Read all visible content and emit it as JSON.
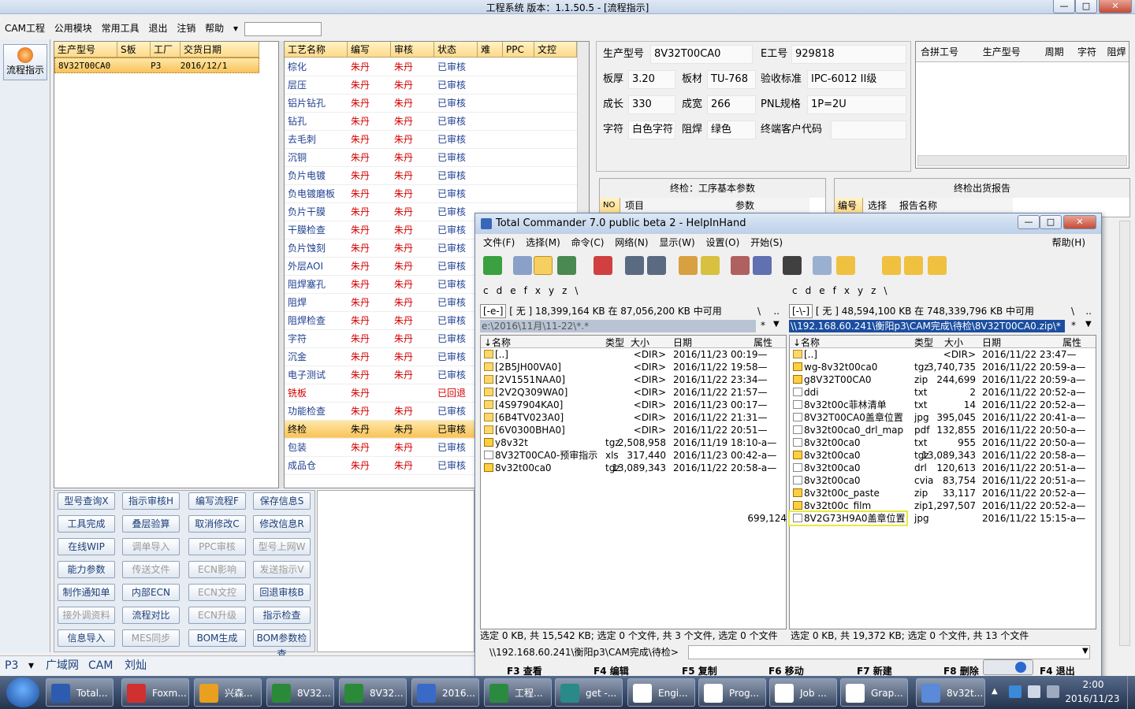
{
  "window": {
    "title": "工程系统  版本：1.1.50.5 - [流程指示]",
    "btn_min": "—",
    "btn_max": "□",
    "btn_close": "✕"
  },
  "menu": [
    "CAM工程",
    "公用模块",
    "常用工具",
    "退出",
    "注销",
    "帮助"
  ],
  "menu_help_arrow": "▾",
  "side": {
    "flow_label": "流程指示"
  },
  "orders": {
    "headers": [
      "生产型号",
      "S板",
      "工厂",
      "交货日期"
    ],
    "row": [
      "8V32T00CA0",
      "",
      "P3",
      "2016/12/1"
    ]
  },
  "process": {
    "headers": [
      "工艺名称",
      "编写",
      "审核",
      "状态",
      "难",
      "PPC",
      "文控"
    ],
    "rows": [
      [
        "棕化",
        "朱丹",
        "朱丹",
        "已审核"
      ],
      [
        "层压",
        "朱丹",
        "朱丹",
        "已审核"
      ],
      [
        "铝片钻孔",
        "朱丹",
        "朱丹",
        "已审核"
      ],
      [
        "钻孔",
        "朱丹",
        "朱丹",
        "已审核"
      ],
      [
        "去毛刺",
        "朱丹",
        "朱丹",
        "已审核"
      ],
      [
        "沉铜",
        "朱丹",
        "朱丹",
        "已审核"
      ],
      [
        "负片电镀",
        "朱丹",
        "朱丹",
        "已审核"
      ],
      [
        "负电镀磨板",
        "朱丹",
        "朱丹",
        "已审核"
      ],
      [
        "负片干膜",
        "朱丹",
        "朱丹",
        "已审核"
      ],
      [
        "干膜检查",
        "朱丹",
        "朱丹",
        "已审核"
      ],
      [
        "负片蚀刻",
        "朱丹",
        "朱丹",
        "已审核"
      ],
      [
        "外层AOI",
        "朱丹",
        "朱丹",
        "已审核"
      ],
      [
        "阻焊塞孔",
        "朱丹",
        "朱丹",
        "已审核"
      ],
      [
        "阻焊",
        "朱丹",
        "朱丹",
        "已审核"
      ],
      [
        "阻焊检查",
        "朱丹",
        "朱丹",
        "已审核"
      ],
      [
        "字符",
        "朱丹",
        "朱丹",
        "已审核"
      ],
      [
        "沉金",
        "朱丹",
        "朱丹",
        "已审核"
      ],
      [
        "电子测试",
        "朱丹",
        "朱丹",
        "已审核"
      ],
      [
        "铣板",
        "朱丹",
        "",
        "已回退"
      ],
      [
        "功能检查",
        "朱丹",
        "朱丹",
        "已审核"
      ],
      [
        "终检",
        "朱丹",
        "朱丹",
        "已审核"
      ],
      [
        "包装",
        "朱丹",
        "朱丹",
        "已审核"
      ],
      [
        "成品仓",
        "朱丹",
        "朱丹",
        "已审核"
      ]
    ]
  },
  "buttons": [
    [
      "型号查询X",
      "指示审核H",
      "编写流程F",
      "保存信息S"
    ],
    [
      "工具完成",
      "叠层验算",
      "取消修改C",
      "修改信息R"
    ],
    [
      "在线WIP",
      "调单导入",
      "PPC审核",
      "型号上网W"
    ],
    [
      "能力参数",
      "传送文件",
      "ECN影响",
      "发送指示V"
    ],
    [
      "制作通知单",
      "内部ECN",
      "ECN文控",
      "回退审核B"
    ],
    [
      "接外调资料",
      "流程对比",
      "ECN升级",
      "指示检查"
    ],
    [
      "信息导入",
      "MES同步",
      "BOM生成",
      "BOM参数检查"
    ]
  ],
  "info": {
    "model_l": "生产型号",
    "model": "8V32T00CA0",
    "eno_l": "E工号",
    "eno": "929818",
    "thick_l": "板厚",
    "thick": "3.20",
    "mat_l": "板材",
    "mat": "TU-768",
    "std_l": "验收标准",
    "std": "IPC-6012 II级",
    "len_l": "成长",
    "len": "330",
    "wid_l": "成宽",
    "wid": "266",
    "pnl_l": "PNL规格",
    "pnl": "1P=2U",
    "char_l": "字符",
    "char": "白色字符",
    "mask_l": "阻焊",
    "mask": "绿色",
    "cust_l": "终端客户代码",
    "cust": ""
  },
  "merge": {
    "headers": [
      "合拼工号",
      "生产型号",
      "周期",
      "字符",
      "阻焊"
    ]
  },
  "final": {
    "title": "终检：工序基本参数",
    "h": [
      "NO",
      "项目",
      "参数"
    ],
    "rtitle": "终检出货报告",
    "rh": [
      "编号",
      "选择",
      "报告名称"
    ]
  },
  "status_bar": {
    "factory": "P3",
    "net": "广域网",
    "mode": "CAM",
    "user": "刘灿"
  },
  "tc": {
    "title": "Total Commander 7.0 public beta 2 - HelpInHand",
    "menu": [
      "文件(F)",
      "选择(M)",
      "命令(C)",
      "网络(N)",
      "显示(W)",
      "设置(O)",
      "开始(S)"
    ],
    "help": "帮助(H)",
    "drives_l": [
      "c",
      "d",
      "e",
      "f",
      "x",
      "y",
      "z",
      "\\"
    ],
    "drives_r": [
      "c",
      "d",
      "e",
      "f",
      "x",
      "y",
      "z",
      "\\"
    ],
    "left": {
      "drive": "[-e-]",
      "free": "[ 无 ]  18,399,164 KB 在 87,056,200 KB 中可用",
      "path": "e:\\2016\\11月\\11-22\\*.*",
      "h": [
        "↓名称",
        "类型",
        "大小",
        "日期",
        "属性"
      ],
      "rows": [
        [
          "[..]",
          "",
          "<DIR>",
          "2016/11/23 00:19—"
        ],
        [
          "[2B5JH00VA0]",
          "",
          "<DIR>",
          "2016/11/22 19:58—"
        ],
        [
          "[2V1551NAA0]",
          "",
          "<DIR>",
          "2016/11/22 23:34—"
        ],
        [
          "[2V2Q309WA0]",
          "",
          "<DIR>",
          "2016/11/22 21:57—"
        ],
        [
          "[4S97904KA0]",
          "",
          "<DIR>",
          "2016/11/23 00:17—"
        ],
        [
          "[6B4TV023A0]",
          "",
          "<DIR>",
          "2016/11/22 21:31—"
        ],
        [
          "[6V0300BHA0]",
          "",
          "<DIR>",
          "2016/11/22 20:51—"
        ],
        [
          "y8v32t",
          "tgz",
          "2,508,958",
          "2016/11/19 18:10-a—"
        ],
        [
          "8V32T00CA0-预审指示",
          "xls",
          "317,440",
          "2016/11/23 00:42-a—"
        ],
        [
          "8v32t00ca0",
          "tgz",
          "13,089,343",
          "2016/11/22 20:58-a—"
        ]
      ],
      "status": "选定 0 KB, 共 15,542 KB; 选定 0 个文件, 共 3 个文件, 选定 0 个文件"
    },
    "right": {
      "drive": "[-\\-]",
      "free": "[ 无 ]  48,594,100 KB 在 748,339,796 KB 中可用",
      "path": "\\\\192.168.60.241\\衡阳p3\\CAM完成\\待检\\8V32T00CA0.zip\\*",
      "h": [
        "↓名称",
        "类型",
        "大小",
        "日期",
        "属性"
      ],
      "rows": [
        [
          "[..]",
          "",
          "<DIR>",
          "2016/11/22 23:47—"
        ],
        [
          "wg-8v32t00ca0",
          "tgz",
          "3,740,735",
          "2016/11/22 20:59-a—"
        ],
        [
          "g8V32T00CA0",
          "zip",
          "244,699",
          "2016/11/22 20:59-a—"
        ],
        [
          "ddi",
          "txt",
          "2",
          "2016/11/22 20:52-a—"
        ],
        [
          "8v32t00c菲林清单",
          "txt",
          "14",
          "2016/11/22 20:52-a—"
        ],
        [
          "8V32T00CA0盖章位置",
          "jpg",
          "395,045",
          "2016/11/22 20:41-a—"
        ],
        [
          "8v32t00ca0_drl_map",
          "pdf",
          "132,855",
          "2016/11/22 20:50-a—"
        ],
        [
          "8v32t00ca0",
          "txt",
          "955",
          "2016/11/22 20:50-a—"
        ],
        [
          "8v32t00ca0",
          "tgz",
          "13,089,343",
          "2016/11/22 20:58-a—"
        ],
        [
          "8v32t00ca0",
          "drl",
          "120,613",
          "2016/11/22 20:51-a—"
        ],
        [
          "8v32t00ca0",
          "cvia",
          "83,754",
          "2016/11/22 20:51-a—"
        ],
        [
          "8v32t00c_paste",
          "zip",
          "33,117",
          "2016/11/22 20:52-a—"
        ],
        [
          "8v32t00c_film",
          "zip",
          "1,297,507",
          "2016/11/22 20:52-a—"
        ],
        [
          "8V2G73H9A0盖章位置",
          "jpg",
          "699,124",
          "2016/11/22 15:15-a—"
        ]
      ],
      "status": "选定 0 KB, 共 19,372 KB; 选定 0 个文件, 共 13 个文件"
    },
    "cmdpath": "\\\\192.168.60.241\\衡阳p3\\CAM完成\\待检>",
    "fkeys": [
      "F3 查看",
      "F4 编辑",
      "F5 复制",
      "F6 移动",
      "F7 新建",
      "F8 删除",
      "F4 退出"
    ]
  },
  "taskbar": {
    "items": [
      "Total...",
      "Foxm...",
      "兴森...",
      "8V32...",
      "8V32...",
      "2016...",
      "工程...",
      "get -...",
      "Engi...",
      "Prog...",
      "Job ...",
      "Grap...",
      "8v32t..."
    ],
    "time": "2:00",
    "date": "2016/11/23"
  }
}
